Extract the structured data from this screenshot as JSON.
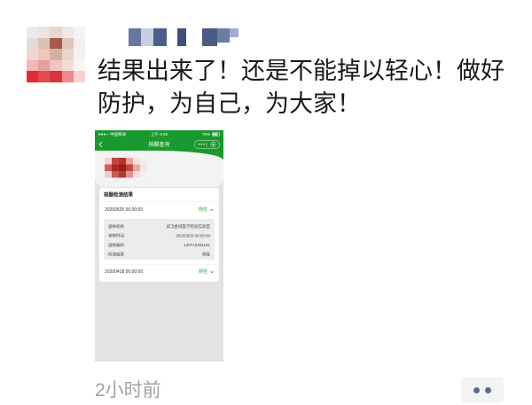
{
  "post": {
    "text_lines": [
      "结果出来了！还是不能掉以轻心！做好",
      "防护，为自己，为大家！"
    ],
    "timestamp": "2小时前",
    "actions_icon": "more-dots-icon"
  },
  "attachment": {
    "status_bar": {
      "carrier": "中国移动",
      "time": "上午 8:48",
      "battery": "79%"
    },
    "nav": {
      "back_icon": "chevron-left-icon",
      "title": "核酸查询",
      "menu_icon": "more-dots-icon",
      "close_icon": "target-circle-icon"
    },
    "result_card": {
      "title": "核酸检测结果",
      "records": [
        {
          "datetime": "20200520 00:00:00",
          "result": "阴性",
          "expanded": true,
          "details": [
            {
              "label": "送样机构",
              "value": "武汉金域医学检验实验室"
            },
            {
              "label": "采样时间",
              "value": "20200520 00:00:00"
            },
            {
              "label": "送样编码",
              "value": "130716391181"
            },
            {
              "label": "检测结果",
              "value": "阴性"
            }
          ]
        },
        {
          "datetime": "20200418 00:00:00",
          "result": "阴性",
          "expanded": false
        }
      ]
    }
  },
  "colors": {
    "wechat_link_blue": "#576b95",
    "mini_program_green": "#1a9a2e",
    "negative_result_green": "#27a343",
    "timestamp_gray": "#a3a3a3"
  }
}
